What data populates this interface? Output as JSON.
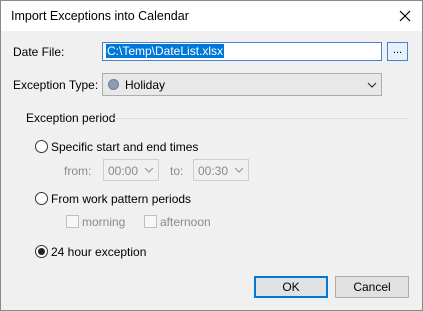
{
  "dialog": {
    "title": "Import Exceptions into Calendar",
    "close_icon": "close-icon"
  },
  "date_file": {
    "label": "Date File:",
    "value": "C:\\Temp\\DateList.xlsx",
    "browse_label": "..."
  },
  "exception_type": {
    "label": "Exception Type:",
    "value": "Holiday",
    "icon": "holiday-icon"
  },
  "exception_period": {
    "group_label": "Exception period",
    "specific": {
      "label": "Specific start and end times",
      "checked": false,
      "from_label": "from:",
      "from_value": "00:00",
      "to_label": "to:",
      "to_value": "00:30"
    },
    "work_pattern": {
      "label": "From work pattern periods",
      "checked": false,
      "options": [
        {
          "label": "morning",
          "checked": false
        },
        {
          "label": "afternoon",
          "checked": false
        }
      ]
    },
    "full_day": {
      "label": "24 hour exception",
      "checked": true
    }
  },
  "buttons": {
    "ok": "OK",
    "cancel": "Cancel"
  },
  "colors": {
    "selection": "#0078d7",
    "focus_border": "#4a7fd6",
    "dialog_bg": "#f0f0f0"
  }
}
